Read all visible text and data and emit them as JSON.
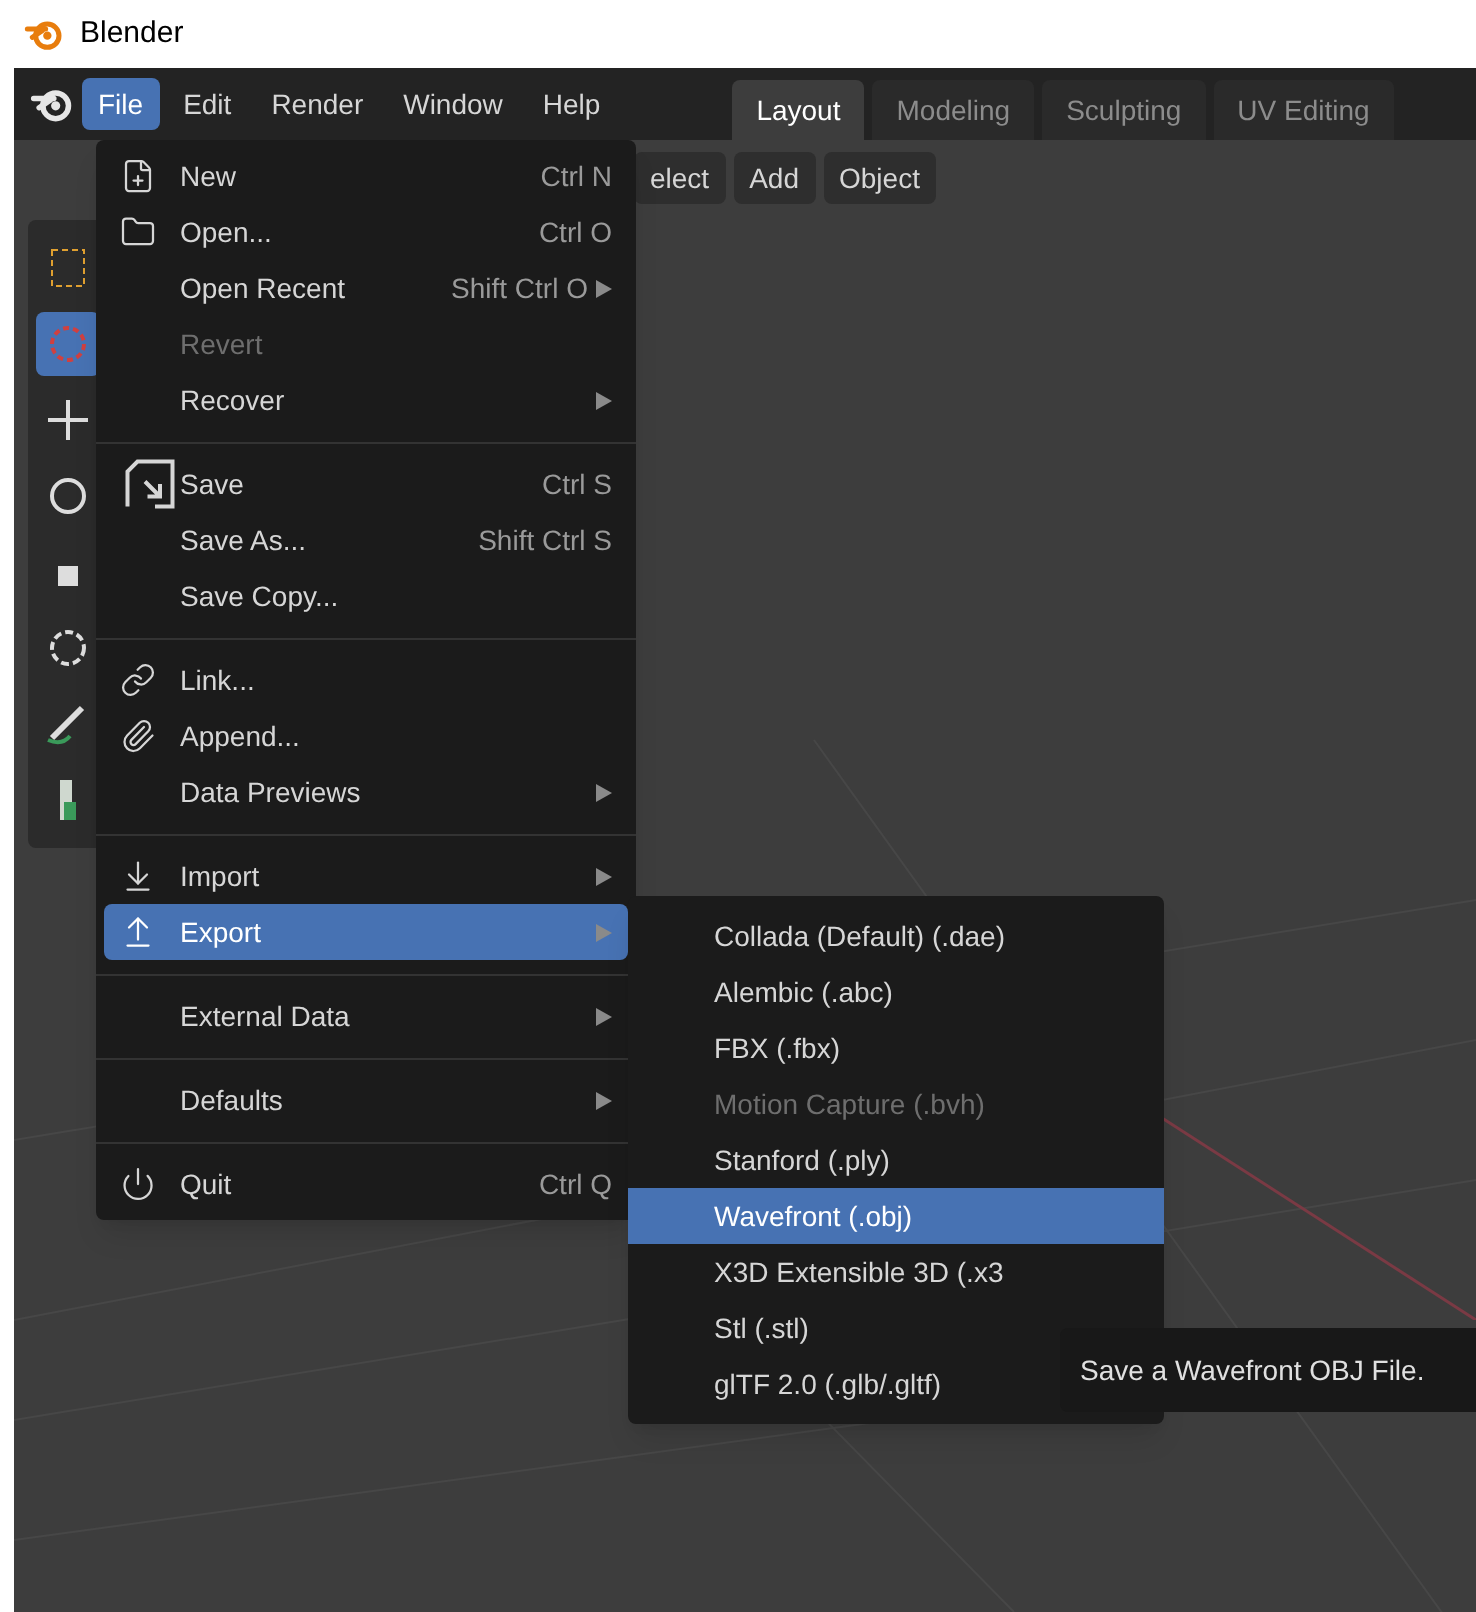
{
  "window": {
    "title": "Blender"
  },
  "menubar": [
    {
      "label": "File",
      "selected": true
    },
    {
      "label": "Edit",
      "selected": false
    },
    {
      "label": "Render",
      "selected": false
    },
    {
      "label": "Window",
      "selected": false
    },
    {
      "label": "Help",
      "selected": false
    }
  ],
  "workspace_tabs": [
    {
      "label": "Layout",
      "selected": true
    },
    {
      "label": "Modeling",
      "selected": false
    },
    {
      "label": "Sculpting",
      "selected": false
    },
    {
      "label": "UV Editing",
      "selected": false
    }
  ],
  "header_buttons": [
    "elect",
    "Add",
    "Object"
  ],
  "file_menu": [
    [
      {
        "label": "New",
        "shortcut": "Ctrl N",
        "submenu": false,
        "disabled": false,
        "selected": false
      },
      {
        "label": "Open...",
        "shortcut": "Ctrl O",
        "submenu": false,
        "disabled": false,
        "selected": false
      },
      {
        "label": "Open Recent",
        "shortcut": "Shift Ctrl O",
        "submenu": true,
        "disabled": false,
        "selected": false
      },
      {
        "label": "Revert",
        "submenu": false,
        "disabled": true,
        "selected": false
      },
      {
        "label": "Recover",
        "submenu": true,
        "disabled": false,
        "selected": false
      }
    ],
    [
      {
        "label": "Save",
        "shortcut": "Ctrl S",
        "submenu": false,
        "disabled": false,
        "selected": false
      },
      {
        "label": "Save As...",
        "shortcut": "Shift Ctrl S",
        "submenu": false,
        "disabled": false,
        "selected": false
      },
      {
        "label": "Save Copy...",
        "submenu": false,
        "disabled": false,
        "selected": false
      }
    ],
    [
      {
        "label": "Link...",
        "submenu": false,
        "disabled": false,
        "selected": false
      },
      {
        "label": "Append...",
        "submenu": false,
        "disabled": false,
        "selected": false
      },
      {
        "label": "Data Previews",
        "submenu": true,
        "disabled": false,
        "selected": false
      }
    ],
    [
      {
        "label": "Import",
        "submenu": true,
        "disabled": false,
        "selected": false
      },
      {
        "label": "Export",
        "submenu": true,
        "disabled": false,
        "selected": true
      }
    ],
    [
      {
        "label": "External Data",
        "submenu": true,
        "disabled": false,
        "selected": false
      }
    ],
    [
      {
        "label": "Defaults",
        "submenu": true,
        "disabled": false,
        "selected": false
      }
    ],
    [
      {
        "label": "Quit",
        "shortcut": "Ctrl Q",
        "submenu": false,
        "disabled": false,
        "selected": false
      }
    ]
  ],
  "export_menu": [
    {
      "label": "Collada (Default) (.dae)",
      "disabled": false,
      "selected": false
    },
    {
      "label": "Alembic (.abc)",
      "disabled": false,
      "selected": false
    },
    {
      "label": "FBX (.fbx)",
      "disabled": false,
      "selected": false
    },
    {
      "label": "Motion Capture (.bvh)",
      "disabled": true,
      "selected": false
    },
    {
      "label": "Stanford (.ply)",
      "disabled": false,
      "selected": false
    },
    {
      "label": "Wavefront (.obj)",
      "disabled": false,
      "selected": true
    },
    {
      "label": "X3D Extensible 3D (.x3",
      "disabled": false,
      "selected": false
    },
    {
      "label": "Stl (.stl)",
      "disabled": false,
      "selected": false
    },
    {
      "label": "glTF 2.0 (.glb/.gltf)",
      "disabled": false,
      "selected": false
    }
  ],
  "tooltip": "Save a Wavefront OBJ File."
}
